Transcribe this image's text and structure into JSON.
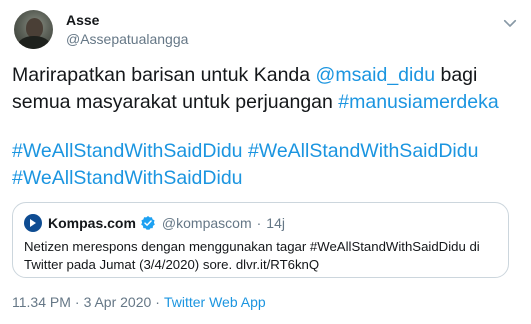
{
  "user": {
    "name": "Asse",
    "handle": "@Assepatualangga"
  },
  "tweet": {
    "line1_text": "Marirapatkan barisan untuk Kanda ",
    "mention": "@msaid_didu",
    "line1_text2": " bagi semua masyarakat untuk perjuangan ",
    "hashtag1": "#manusiamerdeka",
    "hashtag2": "#WeAllStandWithSaidDidu",
    "hashtag3": "#WeAllStandWithSaidDidu",
    "hashtag4": "#WeAllStandWithSaidDidu"
  },
  "quote": {
    "name": "Kompas.com",
    "handle": "@kompascom",
    "separator": "·",
    "time": "14j",
    "text": "Netizen merespons dengan menggunakan tagar #WeAllStandWithSaidDidu di Twitter pada Jumat (3/4/2020) sore. dlvr.it/RT6knQ"
  },
  "footer": {
    "time": "11.34 PM",
    "separator1": "·",
    "date": "3 Apr 2020",
    "separator2": "·",
    "app": "Twitter Web App"
  },
  "colors": {
    "link": "#1b95e0",
    "muted": "#657786",
    "border": "#ccd6dd",
    "verified": "#1da1f2"
  },
  "icons": {
    "avatar": "avatar",
    "menu": "chevron-down-icon",
    "quote_logo": "kompas-logo-icon",
    "verified": "verified-badge-icon"
  }
}
